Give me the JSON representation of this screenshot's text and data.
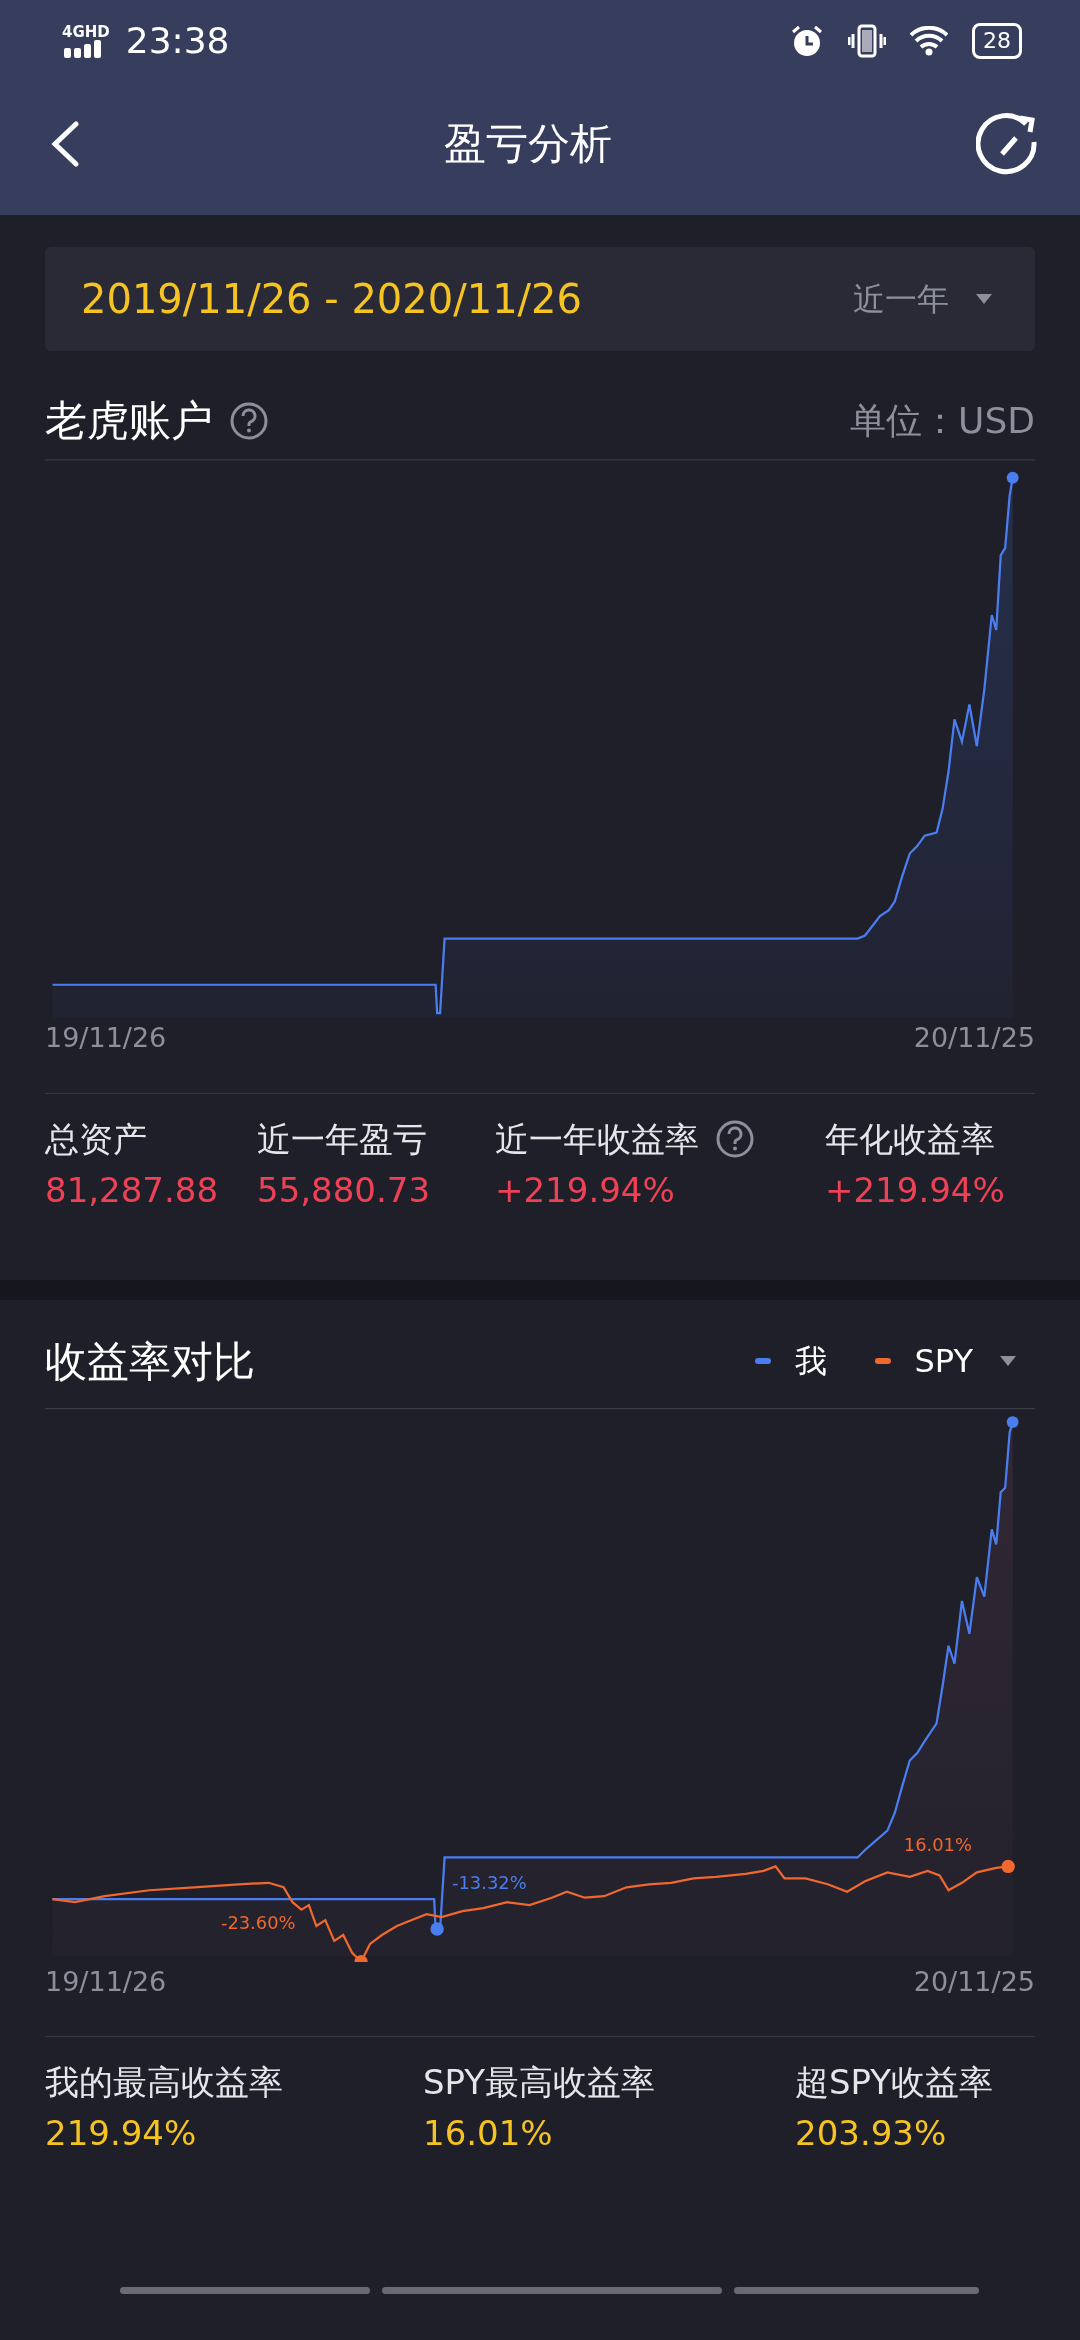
{
  "status_bar": {
    "network": "4GHD",
    "time": "23:38",
    "battery": "28"
  },
  "header": {
    "title": "盈亏分析"
  },
  "date_range": {
    "range": "2019/11/26 - 2020/11/26",
    "period": "近一年"
  },
  "account": {
    "title": "老虎账户",
    "unit": "单位：USD",
    "x_start": "19/11/26",
    "x_end": "20/11/25",
    "stats": [
      {
        "label": "总资产",
        "value": "81,287.88",
        "help": false
      },
      {
        "label": "近一年盈亏",
        "value": "55,880.73",
        "help": false
      },
      {
        "label": "近一年收益率",
        "value": "+219.94%",
        "help": true
      },
      {
        "label": "年化收益率",
        "value": "+219.94%",
        "help": false
      }
    ]
  },
  "comparison": {
    "title": "收益率对比",
    "legend": [
      {
        "name": "我",
        "color": "#4a7ef0"
      },
      {
        "name": "SPY",
        "color": "#f0682e"
      }
    ],
    "labels": [
      {
        "text": "-13.32%",
        "color": "#4a7ef0"
      },
      {
        "text": "-23.60%",
        "color": "#f0682e"
      },
      {
        "text": "16.01%",
        "color": "#f0682e"
      }
    ],
    "x_start": "19/11/26",
    "x_end": "20/11/25",
    "stats": [
      {
        "label": "我的最高收益率",
        "value": "219.94%"
      },
      {
        "label": "SPY最高收益率",
        "value": "16.01%"
      },
      {
        "label": "超SPY收益率",
        "value": "203.93%"
      }
    ]
  }
}
